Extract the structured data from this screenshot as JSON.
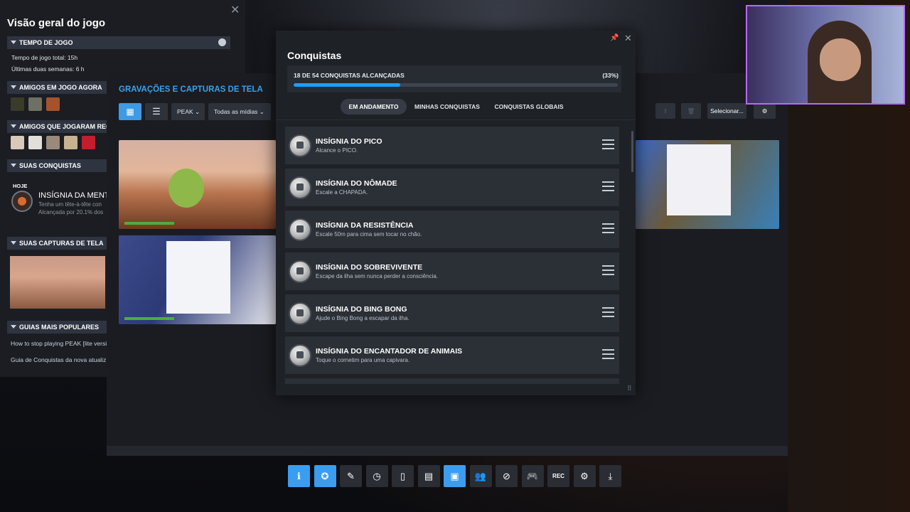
{
  "overview": {
    "title": "Visão geral do jogo",
    "playtime_header": "TEMPO DE JOGO",
    "playtime_total": "Tempo de jogo total: 15h",
    "playtime_recent": "Últimas duas semanas: 6 h",
    "friends_now_header": "AMIGOS EM JOGO AGORA",
    "friends_recent_header": "AMIGOS QUE JOGARAM RECE",
    "your_achievements_header": "SUAS CONQUISTAS",
    "today_label": "HOJE",
    "latest_achievement_name": "INSÍGNIA DA MENT",
    "latest_achievement_desc": "Tenha um tête-à-tête con",
    "latest_achievement_pct": "Alcançada por 20.1% dos",
    "your_screenshots_header": "SUAS CAPTURAS DE TELA",
    "popular_guides_header": "GUIAS MAIS POPULARES",
    "guide_1": "How to stop playing PEAK [lite versi",
    "guide_2": "Guia de Conquistas da nova atualiz"
  },
  "captures": {
    "title": "GRAVAÇÕES E CAPTURAS DE TELA",
    "game_filter": "PEAK",
    "media_filter": "Todas as mídias",
    "select_label": "Selecionar..."
  },
  "achievements": {
    "title": "Conquistas",
    "progress_label": "18 DE 54 CONQUISTAS ALCANÇADAS",
    "progress_pct_label": "(33%)",
    "progress_value": 0.33,
    "tabs": [
      {
        "label": "EM ANDAMENTO",
        "active": true
      },
      {
        "label": "MINHAS CONQUISTAS",
        "active": false
      },
      {
        "label": "CONQUISTAS GLOBAIS",
        "active": false
      }
    ],
    "items": [
      {
        "name": "INSÍGNIA DO PICO",
        "desc": "Alcance o PICO."
      },
      {
        "name": "INSÍGNIA DO NÔMADE",
        "desc": "Escale a CHAPADA."
      },
      {
        "name": "INSÍGNIA DA RESISTÊNCIA",
        "desc": "Escale 50m para cima sem tocar no chão."
      },
      {
        "name": "INSÍGNIA DO SOBREVIVENTE",
        "desc": "Escape da ilha sem nunca perder a consciência."
      },
      {
        "name": "INSÍGNIA DO BING BONG",
        "desc": "Ajude o Bing Bong a escapar da ilha."
      },
      {
        "name": "INSÍGNIA DO ENCANTADOR DE ANIMAIS",
        "desc": "Toque o cornetim para uma capivara."
      }
    ]
  },
  "toolbar": {
    "items": [
      {
        "icon": "info-icon",
        "glyph": "ℹ",
        "active": true
      },
      {
        "icon": "achievement-icon",
        "glyph": "✪",
        "active": true
      },
      {
        "icon": "pencil-icon",
        "glyph": "✎",
        "active": false
      },
      {
        "icon": "clock-icon",
        "glyph": "◷",
        "active": false
      },
      {
        "icon": "guide-icon",
        "glyph": "▯",
        "active": false
      },
      {
        "icon": "chat-icon",
        "glyph": "▤",
        "active": false
      },
      {
        "icon": "screenshots-icon",
        "glyph": "▣",
        "active": true
      },
      {
        "icon": "friends-icon",
        "glyph": "👥",
        "active": false
      },
      {
        "icon": "compass-icon",
        "glyph": "⊘",
        "active": false
      },
      {
        "icon": "controller-icon",
        "glyph": "🎮",
        "active": false
      },
      {
        "icon": "rec-icon",
        "glyph": "REC",
        "active": false
      },
      {
        "icon": "settings-icon",
        "glyph": "⚙",
        "active": false
      },
      {
        "icon": "minimize-icon",
        "glyph": "⤓",
        "active": false
      }
    ]
  },
  "colors": {
    "accent": "#1a9fff",
    "panel": "#1e2126",
    "row": "#2b2f36"
  }
}
